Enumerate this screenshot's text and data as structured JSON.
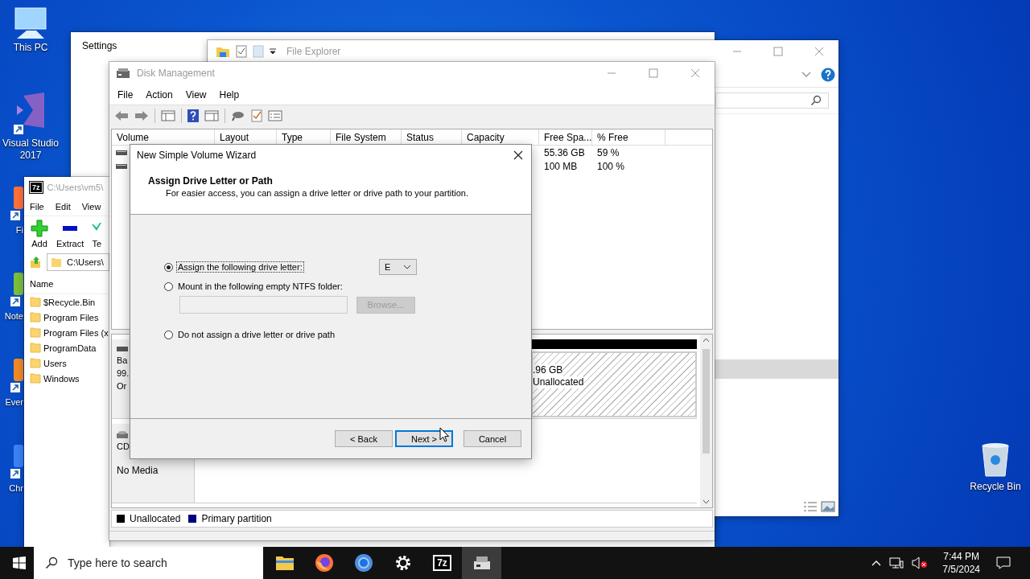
{
  "desktop": {
    "icons": [
      {
        "label": "This PC",
        "kind": "pc"
      },
      {
        "label": "Visual Studio 2017",
        "kind": "vs"
      }
    ],
    "covered_icons": [
      {
        "label": "Fi",
        "kind": "firefox"
      },
      {
        "label": "Note",
        "kind": "notepad"
      },
      {
        "label": "Ever",
        "kind": "evernote"
      },
      {
        "label": "Chr",
        "kind": "chrome"
      }
    ],
    "recycle_bin": {
      "label": "Recycle Bin"
    }
  },
  "settings": {
    "title": "Settings"
  },
  "file_explorer": {
    "title": "File Explorer"
  },
  "zip_manager": {
    "logo": "7z",
    "title": "C:\\Users\\vm5\\",
    "menu": [
      "File",
      "Edit",
      "View"
    ],
    "toolbar": [
      {
        "label": "Add",
        "kind": "add"
      },
      {
        "label": "Extract",
        "kind": "extract"
      },
      {
        "label": "Te",
        "kind": "test"
      }
    ],
    "address": "C:\\Users\\",
    "column": "Name",
    "items": [
      "$Recycle.Bin",
      "Program Files",
      "Program Files (x",
      "ProgramData",
      "Users",
      "Windows"
    ]
  },
  "disk_management": {
    "title": "Disk Management",
    "menu": [
      "File",
      "Action",
      "View",
      "Help"
    ],
    "columns": [
      "Volume",
      "Layout",
      "Type",
      "File System",
      "Status",
      "Capacity",
      "Free Spa...",
      "% Free"
    ],
    "rows": [
      {
        "free_space": "55.36 GB",
        "percent_free": "59 %"
      },
      {
        "free_space": "100 MB",
        "percent_free": "100 %"
      }
    ],
    "disks": [
      {
        "kind": "disk",
        "lines": [
          "Ba",
          "99.",
          "Or"
        ],
        "partition": {
          "size": ".96 GB",
          "status": "Unallocated"
        }
      },
      {
        "kind": "cdrom",
        "lines": [
          "CD",
          "No Media"
        ]
      }
    ],
    "legend": [
      {
        "label": "Unallocated",
        "color": "#000000"
      },
      {
        "label": "Primary partition",
        "color": "#000080"
      }
    ]
  },
  "wizard": {
    "title": "New Simple Volume Wizard",
    "heading": "Assign Drive Letter or Path",
    "subheading": "For easier access, you can assign a drive letter or drive path to your partition.",
    "options": [
      {
        "label": "Assign the following drive letter:",
        "selected": true
      },
      {
        "label": "Mount in the following empty NTFS folder:",
        "selected": false
      },
      {
        "label": "Do not assign a drive letter or drive path",
        "selected": false
      }
    ],
    "drive_letter": "E",
    "folder_field": {
      "disabled": true
    },
    "browse": {
      "label": "Browse...",
      "disabled": true
    },
    "buttons": [
      {
        "label": "< Back",
        "default": false
      },
      {
        "label": "Next >",
        "default": true
      },
      {
        "label": "Cancel",
        "default": false
      }
    ]
  },
  "taskbar": {
    "search_placeholder": "Type here to search",
    "apps": [
      {
        "kind": "folder",
        "selected": false
      },
      {
        "kind": "firefox",
        "selected": false
      },
      {
        "kind": "chrome",
        "selected": false
      },
      {
        "kind": "settings",
        "selected": false
      },
      {
        "kind": "archiver",
        "label": "7z",
        "selected": false
      },
      {
        "kind": "disk",
        "selected": true
      }
    ],
    "time": "7:44 PM",
    "date": "7/5/2024"
  }
}
